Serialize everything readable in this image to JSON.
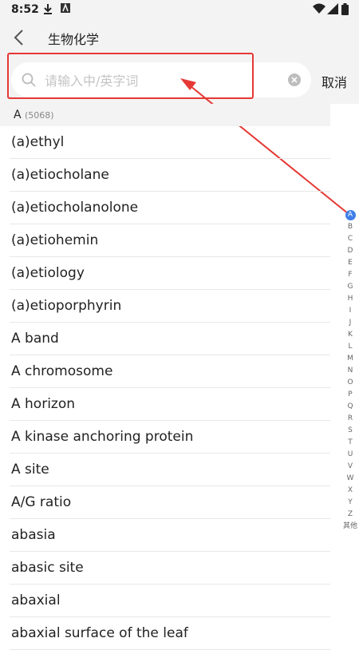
{
  "status_bar": {
    "time": "8:52"
  },
  "header": {
    "title": "生物化学"
  },
  "search": {
    "placeholder": "请输入中/英字词",
    "value": "",
    "cancel_label": "取消"
  },
  "section": {
    "letter": "A",
    "count": "(5068)"
  },
  "words": [
    "(a)ethyl",
    "(a)etiocholane",
    "(a)etiocholanolone",
    "(a)etiohemin",
    "(a)etiology",
    "(a)etioporphyrin",
    "A band",
    "A chromosome",
    "A horizon",
    "A kinase anchoring protein",
    "A site",
    "A/G ratio",
    "abasia",
    "abasic site",
    "abaxial",
    "abaxial surface of the leaf"
  ],
  "index_letters": [
    "A",
    "B",
    "C",
    "D",
    "E",
    "F",
    "G",
    "H",
    "I",
    "J",
    "K",
    "L",
    "M",
    "N",
    "O",
    "P",
    "Q",
    "R",
    "S",
    "T",
    "U",
    "V",
    "W",
    "X",
    "Y",
    "Z",
    "其他"
  ],
  "active_index": "A",
  "colors": {
    "annotation": "#e53935",
    "accent": "#3f7fe8",
    "header_bg": "#f3f3f3"
  }
}
